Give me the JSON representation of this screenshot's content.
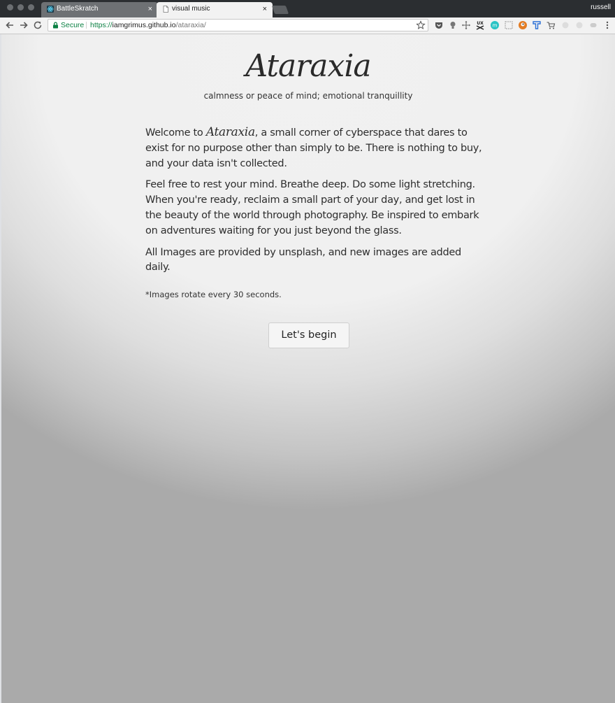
{
  "browser": {
    "profile_name": "russell",
    "tabs": [
      {
        "title": "BattleSkratch",
        "active": false,
        "icon": "react-favicon-icon"
      },
      {
        "title": "visual music",
        "active": true,
        "icon": "page-icon"
      }
    ],
    "tab_close_glyph": "×",
    "omnibox": {
      "secure_label": "Secure",
      "url_scheme": "https://",
      "url_host": "iamgrimus.github.io",
      "url_path": "/ataraxia/"
    },
    "extension_icons": [
      "pocket-icon",
      "lightbulb-icon",
      "move-icon",
      "ux-icon",
      "m-icon",
      "screenshot-icon",
      "duckduckgo-icon",
      "tampermonkey-icon",
      "cart-icon",
      "ext-disabled-icon",
      "ext-disabled-icon",
      "ext-disabled-icon",
      "menu-icon"
    ],
    "accent_secure": "#0b8043"
  },
  "page": {
    "title": "Ataraxia",
    "subtitle": "calmness or peace of mind; emotional tranquillity",
    "para1_before": "Welcome to ",
    "para1_brand": "Ataraxia",
    "para1_after": ", a small corner of cyberspace that dares to exist for no purpose other than simply to be. There is nothing to buy, and your data isn't collected.",
    "para2": "Feel free to rest your mind. Breathe deep. Do some light stretching. When you're ready, reclaim a small part of your day, and get lost in the beauty of the world through photography. Be inspired to embark on adventures waiting for you just beyond the glass.",
    "para3": "All Images are provided by unsplash, and new images are added daily.",
    "note": "*Images rotate every 30 seconds.",
    "begin_button": "Let's begin"
  }
}
